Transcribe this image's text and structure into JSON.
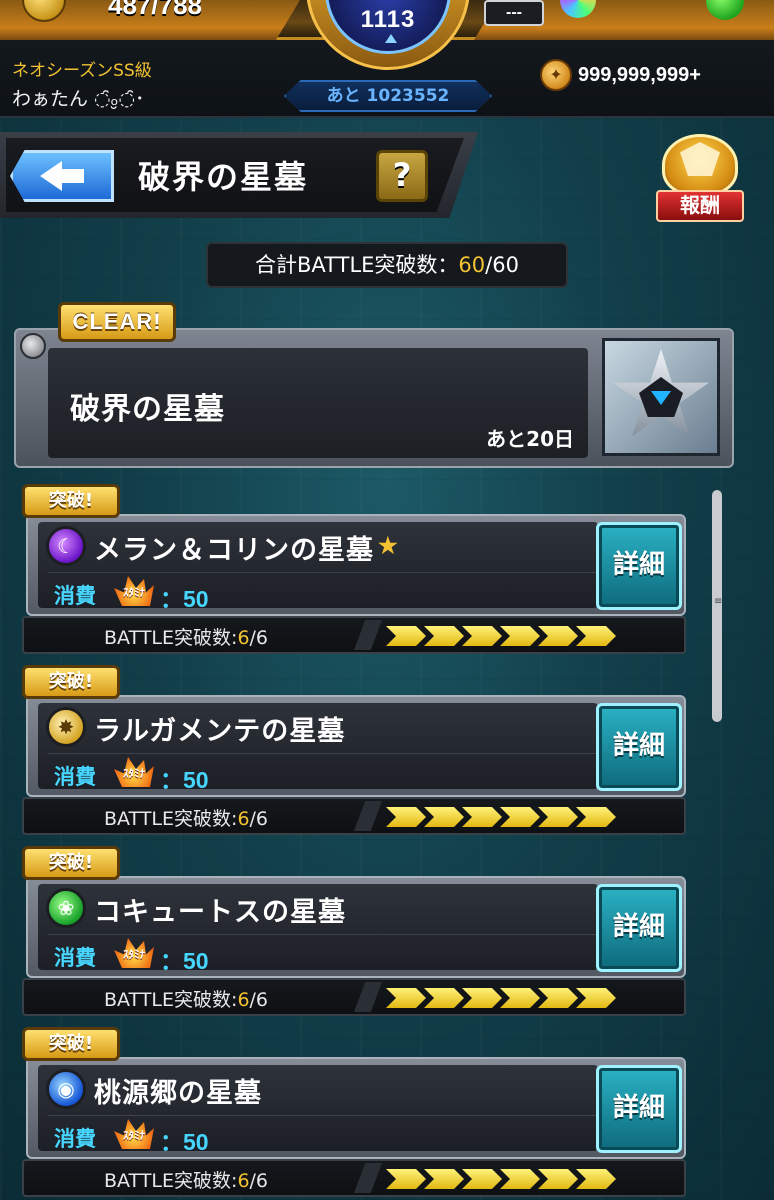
{
  "hud": {
    "stamina_text": "487/788",
    "level": "1113",
    "dash_box": "---",
    "rank_label": "ネオシーズンSS級",
    "user_name": "わぁたん ◌̑ₒ̮◌̑･",
    "remaining_label": "あと 1023552",
    "gold_value": "999,999,999+",
    "gold_icon": "coin-icon"
  },
  "title_bar": {
    "title": "破界の星墓",
    "help_label": "?",
    "reward_label": "報酬"
  },
  "total": {
    "prefix": "合計BATTLE突破数：",
    "current": "60",
    "separator": "/",
    "max": "60"
  },
  "event": {
    "clear_label": "CLEAR!",
    "name": "破界の星墓",
    "days_left": "あと20日"
  },
  "stages": [
    {
      "badge": "突破!",
      "element": "dark",
      "element_icon": "dark-element-icon",
      "name": "メラン＆コリンの星墓",
      "star": "★",
      "cost_label": "消費",
      "stamina_tag": "ｽﾀﾐﾅ",
      "cost_value": "：50",
      "detail_label": "詳細",
      "progress_prefix": "BATTLE突破数:",
      "progress_current": "6",
      "progress_rest": "/6",
      "progress_fraction": 1.0
    },
    {
      "badge": "突破!",
      "element": "light",
      "element_icon": "light-element-icon",
      "name": "ラルガメンテの星墓",
      "star": "",
      "cost_label": "消費",
      "stamina_tag": "ｽﾀﾐﾅ",
      "cost_value": "：50",
      "detail_label": "詳細",
      "progress_prefix": "BATTLE突破数:",
      "progress_current": "6",
      "progress_rest": "/6",
      "progress_fraction": 1.0
    },
    {
      "badge": "突破!",
      "element": "wood",
      "element_icon": "wood-element-icon",
      "name": "コキュートスの星墓",
      "star": "",
      "cost_label": "消費",
      "stamina_tag": "ｽﾀﾐﾅ",
      "cost_value": "：50",
      "detail_label": "詳細",
      "progress_prefix": "BATTLE突破数:",
      "progress_current": "6",
      "progress_rest": "/6",
      "progress_fraction": 1.0
    },
    {
      "badge": "突破!",
      "element": "water",
      "element_icon": "water-element-icon",
      "name": "桃源郷の星墓",
      "star": "",
      "cost_label": "消費",
      "stamina_tag": "ｽﾀﾐﾅ",
      "cost_value": "：50",
      "detail_label": "詳細",
      "progress_prefix": "BATTLE突破数:",
      "progress_current": "6",
      "progress_rest": "/6",
      "progress_fraction": 1.0
    }
  ],
  "colors": {
    "accent_gold": "#f2c232",
    "cost_cyan": "#46d6ff",
    "detail_teal": "#1a8fa0",
    "back_blue": "#1d6ad6"
  }
}
